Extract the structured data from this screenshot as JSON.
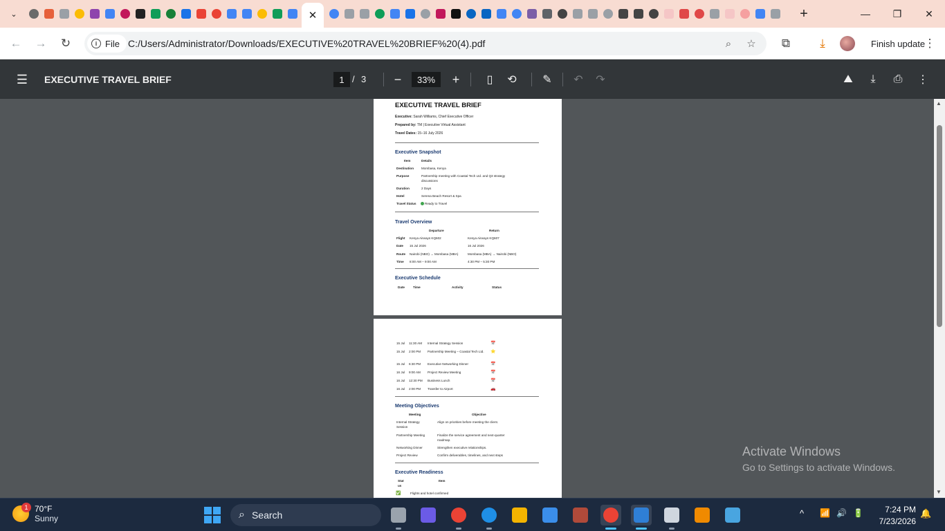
{
  "browser": {
    "active_tab_close": "✕",
    "new_tab": "+",
    "tab_search": "⌄",
    "window": {
      "minimize": "—",
      "maximize": "❐",
      "close": "✕"
    },
    "toolbar": {
      "back": "←",
      "forward": "→",
      "reload": "↻",
      "site_chip": "File",
      "url": "C:/Users/Administrator/Downloads/EXECUTIVE%20TRAVEL%20BRIEF%20(4).pdf",
      "zoom_icon": "⌕",
      "bookmark_icon": "☆",
      "extensions_icon": "⧉",
      "download_icon": "⤓",
      "finish_update": "Finish update",
      "more": "⋮"
    },
    "tab_icon_colors": [
      "#6a6a6a",
      "#e6603b",
      "#9aa0a6",
      "#fbbc04",
      "#8e44ad",
      "#4285f4",
      "#c2185b",
      "#222222",
      "#0f9d58",
      "#188038",
      "#1a73e8",
      "#ea4335",
      "#ea4335",
      "#4285f4",
      "#4285f4",
      "#fbbc04",
      "#0f9d58",
      "#4285f4"
    ],
    "tab_icon_colors_right": [
      "#4285f4",
      "#9aa0a6",
      "#9aa0a6",
      "#0f9d58",
      "#4285f4",
      "#1a73e8",
      "#9aa0a6",
      "#c2185b",
      "#111111",
      "#0a66c2",
      "#0a66c2",
      "#4285f4",
      "#4285f4",
      "#7b5ea7",
      "#5f6368",
      "#444444",
      "#9aa0a6",
      "#9aa0a6",
      "#9aa0a6",
      "#444444",
      "#444444",
      "#444444",
      "#f5c6c6",
      "#e04848",
      "#e04848",
      "#9aa0a6",
      "#f5c6c6",
      "#f5a0a0",
      "#4285f4",
      "#9aa0a6"
    ]
  },
  "pdf_viewer": {
    "menu_icon": "☰",
    "title": "EXECUTIVE TRAVEL BRIEF",
    "current_page": "1",
    "page_separator": "/",
    "total_pages": "3",
    "zoom_out": "−",
    "zoom": "33%",
    "zoom_in": "+",
    "fit_icon": "▯",
    "rotate_icon": "⟲",
    "annotate_icon": "✎",
    "undo_icon": "↶",
    "redo_icon": "↷",
    "drive_icon": "⛰",
    "download_icon": "⤓",
    "print_icon": "⎙",
    "more_icon": "⋮"
  },
  "document": {
    "page1": {
      "title": "EXECUTIVE TRAVEL BRIEF",
      "executive_label": "Executive:",
      "executive": "Sarah Williams, Chief Executive Officer",
      "prepared_label": "Prepared by:",
      "prepared": "TM | Executive Virtual Assistant",
      "dates_label": "Travel Dates:",
      "dates": "15–16 July 2026",
      "snapshot_heading": "Executive Snapshot",
      "snapshot_headers": [
        "Item",
        "Details"
      ],
      "snapshot_rows": [
        {
          "item": "Destination",
          "detail": "Mombasa, Kenya"
        },
        {
          "item": "Purpose",
          "detail": "Partnership meeting with Coastal Tech Ltd. and Q3 strategy discussions"
        },
        {
          "item": "Duration",
          "detail": "2 Days"
        },
        {
          "item": "Hotel",
          "detail": "Serena Beach Resort & Spa"
        },
        {
          "item": "Travel Status",
          "detail": "Ready to Travel"
        }
      ],
      "overview_heading": "Travel Overview",
      "overview_headers": [
        "",
        "Departure",
        "Return"
      ],
      "overview_rows": [
        {
          "label": "Flight",
          "dep": "Kenya Airways KQ602",
          "ret": "Kenya Airways KQ607"
        },
        {
          "label": "Date",
          "dep": "15 Jul 2026",
          "ret": "16 Jul 2026"
        },
        {
          "label": "Route",
          "dep": "Nairobi (NBO) → Mombasa (MBA)",
          "ret": "Mombasa (MBA) → Nairobi (NBO)"
        },
        {
          "label": "Time",
          "dep": "8:00 AM – 9:00 AM",
          "ret": "4:30 PM – 5:30 PM"
        }
      ],
      "schedule_heading": "Executive Schedule",
      "schedule_headers": [
        "Date",
        "Time",
        "Activity",
        "Status"
      ]
    },
    "page2": {
      "schedule_rows": [
        {
          "date": "15 Jul",
          "time": "11:30 AM",
          "activity": "Internal Strategy Session",
          "status": "📅"
        },
        {
          "date": "15 Jul",
          "time": "2:00 PM",
          "activity": "Partnership Meeting – Coastal Tech Ltd.",
          "status": "⭐"
        },
        {
          "date": "15 Jul",
          "time": "6:30 PM",
          "activity": "Executive Networking Dinner",
          "status": "📅"
        },
        {
          "date": "16 Jul",
          "time": "9:00 AM",
          "activity": "Project Review Meeting",
          "status": "📅"
        },
        {
          "date": "16 Jul",
          "time": "12:30 PM",
          "activity": "Business Lunch",
          "status": "📅"
        },
        {
          "date": "16 Jul",
          "time": "2:00 PM",
          "activity": "Transfer to Airport",
          "status": "🚗"
        }
      ],
      "objectives_heading": "Meeting Objectives",
      "objectives_headers": [
        "Meeting",
        "Objective"
      ],
      "objectives_rows": [
        {
          "meeting": "Internal Strategy Session",
          "objective": "Align on priorities before meeting the client."
        },
        {
          "meeting": "Partnership Meeting",
          "objective": "Finalize the service agreement and next-quarter roadmap."
        },
        {
          "meeting": "Networking Dinner",
          "objective": "Strengthen executive relationships."
        },
        {
          "meeting": "Project Review",
          "objective": "Confirm deliverables, timelines, and next steps"
        }
      ],
      "readiness_heading": "Executive Readiness",
      "readiness_headers": [
        "Status",
        "Item"
      ],
      "readiness_rows": [
        {
          "status": "✅",
          "item": "Flights and hotel confirmed"
        }
      ]
    }
  },
  "watermark": {
    "line1": "Activate Windows",
    "line2": "Go to Settings to activate Windows."
  },
  "taskbar": {
    "weather_badge": "1",
    "temperature": "70°F",
    "condition": "Sunny",
    "search_placeholder": "Search",
    "search_icon": "⌕",
    "tray_chevron": "^",
    "wifi_icon": "📶",
    "volume_icon": "🔊",
    "battery_icon": "🔋",
    "bell_icon": "🔔",
    "time": "7:24 PM",
    "date": "7/23/2026",
    "app_colors": [
      "#9aa3ad",
      "#6b5be6",
      "#ea4335",
      "#1f8fe6",
      "#f4b400",
      "#3b8eea",
      "#b04a3a",
      "#ea4335",
      "#2f7fd6",
      "#cfd6df",
      "#f08a00",
      "#49a5e0"
    ]
  }
}
